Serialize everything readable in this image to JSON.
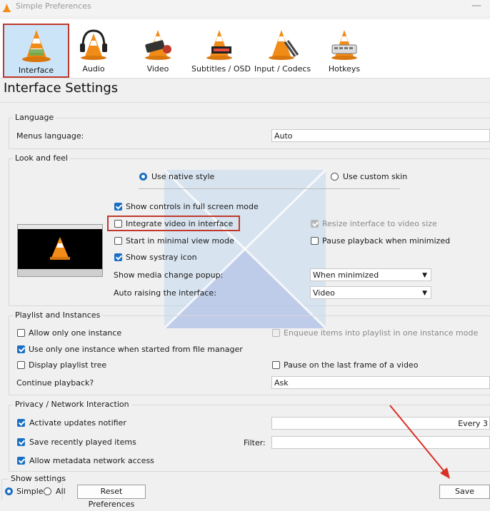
{
  "window": {
    "title": "Simple Preferences"
  },
  "toolbar": {
    "items": [
      {
        "label": "Interface"
      },
      {
        "label": "Audio"
      },
      {
        "label": "Video"
      },
      {
        "label": "Subtitles / OSD"
      },
      {
        "label": "Input / Codecs"
      },
      {
        "label": "Hotkeys"
      }
    ]
  },
  "page": {
    "heading": "Interface Settings"
  },
  "language": {
    "group_title": "Language",
    "menus_label": "Menus language:",
    "menus_value": "Auto"
  },
  "look": {
    "group_title": "Look and feel",
    "native_style": "Use native style",
    "custom_skin": "Use custom skin",
    "show_controls": "Show controls in full screen mode",
    "integrate_video": "Integrate video in interface",
    "minimal_view": "Start in minimal view mode",
    "systray": "Show systray icon",
    "resize_interface": "Resize interface to video size",
    "pause_minimized": "Pause playback when minimized",
    "media_popup_label": "Show media change popup:",
    "media_popup_value": "When minimized",
    "auto_raise_label": "Auto raising the interface:",
    "auto_raise_value": "Video"
  },
  "playlist": {
    "group_title": "Playlist and Instances",
    "one_instance": "Allow only one instance",
    "enqueue": "Enqueue items into playlist in one instance mode",
    "file_manager": "Use only one instance when started from file manager",
    "playlist_tree": "Display playlist tree",
    "pause_last_frame": "Pause on the last frame of a video",
    "continue_label": "Continue playback?",
    "continue_value": "Ask"
  },
  "privacy": {
    "group_title": "Privacy / Network Interaction",
    "updates": "Activate updates notifier",
    "updates_value": "Every 3",
    "recent": "Save recently played items",
    "filter_label": "Filter:",
    "metadata": "Allow metadata network access"
  },
  "footer": {
    "show_settings": "Show settings",
    "simple": "Simple",
    "all": "All",
    "reset": "Reset Preferences",
    "save": "Save"
  },
  "colors": {
    "accent": "#1a6fc4",
    "highlight": "#c0392b",
    "cone": "#f28c18"
  },
  "icons": [
    "vlc-cone-icon",
    "headphones-icon",
    "film-icon",
    "subtitles-icon",
    "codec-icon",
    "hotkeys-icon"
  ]
}
